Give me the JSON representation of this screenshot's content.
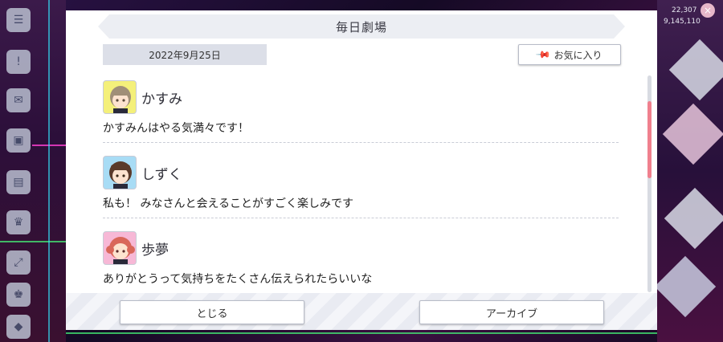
{
  "dialog": {
    "title": "毎日劇場",
    "date": "2022年9月25日",
    "favorite_label": "お気に入り",
    "close_label": "とじる",
    "archive_label": "アーカイブ"
  },
  "entries": [
    {
      "name": "かすみ",
      "line": "かすみんはやる気満々です！",
      "avatar_bg": "#f4f07a"
    },
    {
      "name": "しずく",
      "line": "私も！ みなさんと会えることがすごく楽しみです",
      "avatar_bg": "#a8dcf5"
    },
    {
      "name": "歩夢",
      "line": "ありがとうって気持ちをたくさん伝えられたらいいな",
      "avatar_bg": "#f7b8d6"
    }
  ],
  "hud": {
    "top_value_1": "22,307",
    "top_value_2": "9,145,110"
  },
  "colors": {
    "scroll_thumb": "#f0808e",
    "dialog_bg": "#ffffff"
  }
}
